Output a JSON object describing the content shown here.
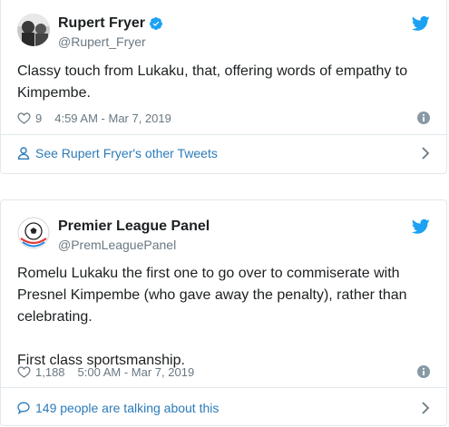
{
  "tweets": [
    {
      "name": "Rupert Fryer",
      "handle": "@Rupert_Fryer",
      "verified": true,
      "text": "Classy touch from Lukaku, that, offering words of empathy to Kimpembe.",
      "likes": "9",
      "timestamp": "4:59 AM - Mar 7, 2019",
      "footer": "See Rupert Fryer's other Tweets",
      "footer_icon": "person-icon"
    },
    {
      "name": "Premier League Panel",
      "handle": "@PremLeaguePanel",
      "verified": false,
      "text": "Romelu Lukaku the first one to go over to commiserate with Presnel Kimpembe (who gave away the penalty), rather than celebrating.\n\nFirst class sportsmanship.",
      "likes": "1,188",
      "timestamp": "5:00 AM - Mar 7, 2019",
      "footer": "149 people are talking about this",
      "footer_icon": "speech-bubble-icon"
    }
  ],
  "colors": {
    "twitter_blue": "#1da1f2",
    "link_blue": "#2b7bb9",
    "meta_gray": "#697882",
    "border": "#e1e8ed"
  }
}
